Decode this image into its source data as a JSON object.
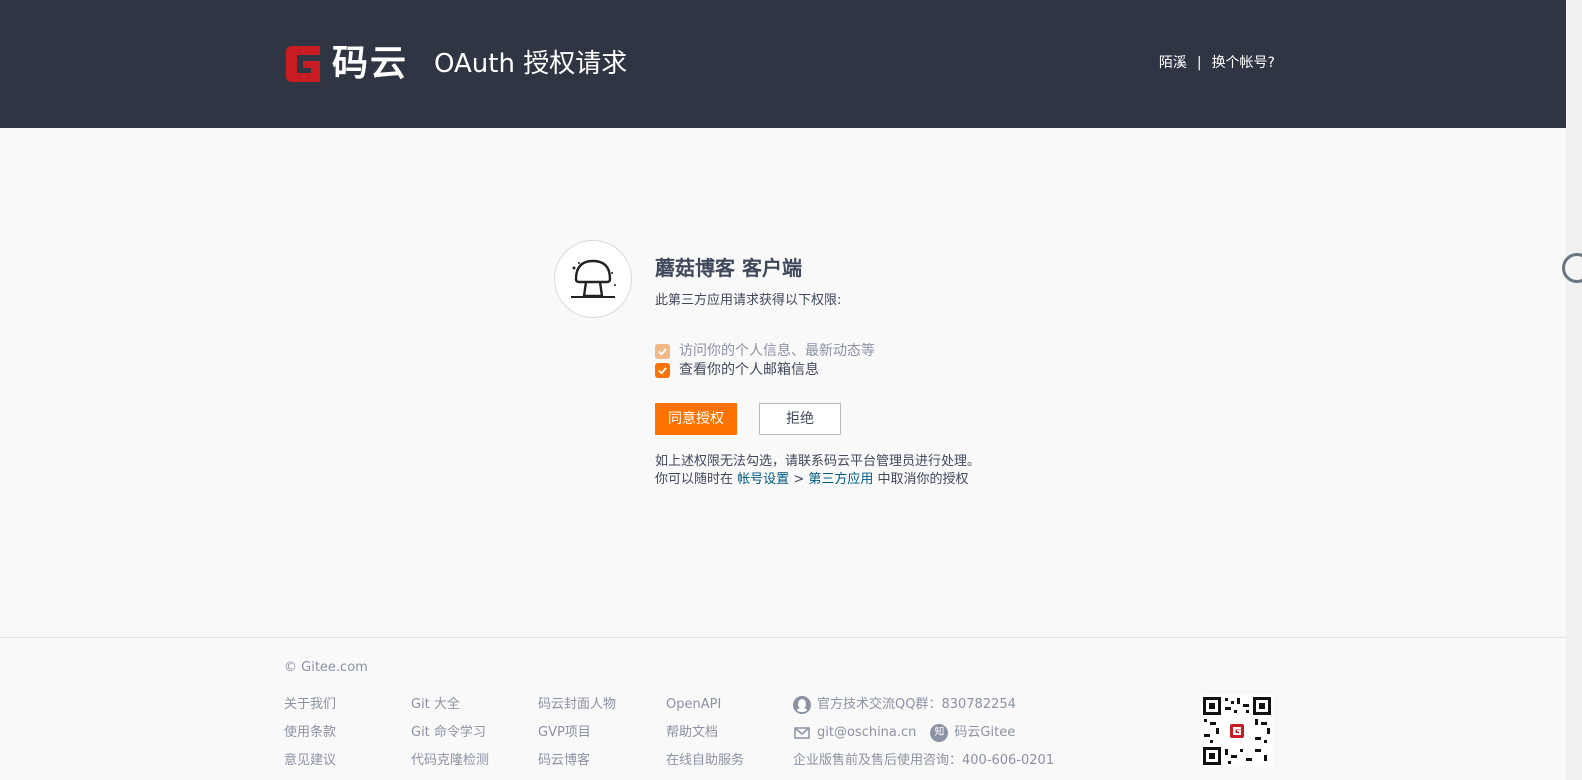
{
  "header": {
    "brand": "码云",
    "title": "OAuth 授权请求",
    "user_name": "陌溪",
    "separator": "|",
    "switch_account": "换个帐号?"
  },
  "auth": {
    "app_name": "蘑菇博客 客户端",
    "description": "此第三方应用请求获得以下权限:",
    "permissions": [
      {
        "label": "访问你的个人信息、最新动态等",
        "checked": true,
        "disabled": true
      },
      {
        "label": "查看你的个人邮箱信息",
        "checked": true,
        "disabled": false
      }
    ],
    "agree_label": "同意授权",
    "deny_label": "拒绝",
    "note_line1": "如上述权限无法勾选，请联系码云平台管理员进行处理。",
    "note_prefix": "你可以随时在",
    "account_settings_link": "帐号设置",
    "arrow": ">",
    "third_party_link": "第三方应用",
    "note_suffix": "中取消你的授权"
  },
  "footer": {
    "copyright": "© Gitee.com",
    "columns": [
      [
        "关于我们",
        "使用条款",
        "意见建议"
      ],
      [
        "Git 大全",
        "Git 命令学习",
        "代码克隆检测"
      ],
      [
        "码云封面人物",
        "GVP项目",
        "码云博客"
      ],
      [
        "OpenAPI",
        "帮助文档",
        "在线自助服务"
      ]
    ],
    "qq_group": "官方技术交流QQ群：830782254",
    "email": "git@oschina.cn",
    "zhihu_icon_text": "知",
    "zhihu": "码云Gitee",
    "hotline": "企业版售前及售后使用咨询：400-606-0201"
  },
  "colors": {
    "header_bg": "#2f3542",
    "accent": "#fe7300",
    "brand_red": "#c71d23",
    "link": "#005980"
  }
}
